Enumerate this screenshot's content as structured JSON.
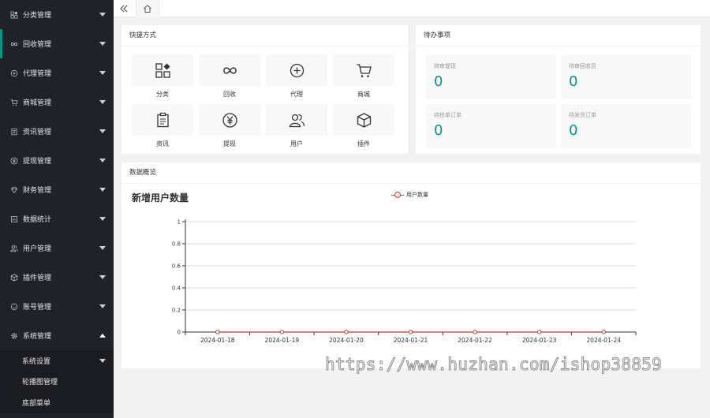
{
  "sidebar": {
    "items": [
      {
        "label": "分类管理",
        "icon": "category-icon"
      },
      {
        "label": "回收管理",
        "icon": "infinity-icon"
      },
      {
        "label": "代理管理",
        "icon": "plus-circle-icon"
      },
      {
        "label": "商城管理",
        "icon": "cart-icon"
      },
      {
        "label": "资讯管理",
        "icon": "document-icon"
      },
      {
        "label": "提现管理",
        "icon": "yen-icon"
      },
      {
        "label": "财务管理",
        "icon": "diamond-icon"
      },
      {
        "label": "数据统计",
        "icon": "chart-icon"
      },
      {
        "label": "用户管理",
        "icon": "users-icon"
      },
      {
        "label": "插件管理",
        "icon": "box-icon"
      },
      {
        "label": "账号管理",
        "icon": "smile-icon"
      },
      {
        "label": "系统管理",
        "icon": "gear-icon"
      }
    ],
    "active_index": 1,
    "expanded_index": 11,
    "submenu": [
      {
        "label": "系统设置"
      },
      {
        "label": "轮播图管理"
      },
      {
        "label": "底部菜单"
      }
    ]
  },
  "topbar": {
    "collapse_icon": "double-chevron-left-icon",
    "home_icon": "home-icon"
  },
  "quick": {
    "title": "快捷方式",
    "items": [
      {
        "label": "分类",
        "icon": "category-icon"
      },
      {
        "label": "回收",
        "icon": "infinity-icon"
      },
      {
        "label": "代理",
        "icon": "plus-circle-icon"
      },
      {
        "label": "商城",
        "icon": "cart-icon"
      },
      {
        "label": "资讯",
        "icon": "clipboard-icon"
      },
      {
        "label": "提现",
        "icon": "yen-icon"
      },
      {
        "label": "用户",
        "icon": "users-icon"
      },
      {
        "label": "插件",
        "icon": "box-icon"
      }
    ]
  },
  "todo": {
    "title": "待办事项",
    "items": [
      {
        "label": "待审提现",
        "value": "0"
      },
      {
        "label": "待审回收员",
        "value": "0"
      },
      {
        "label": "待抢单订单",
        "value": "0"
      },
      {
        "label": "待发货订单",
        "value": "0"
      }
    ]
  },
  "overview": {
    "title": "数据概览"
  },
  "chart_data": {
    "type": "line",
    "title": "新增用户数量",
    "x": [
      "2024-01-18",
      "2024-01-19",
      "2024-01-20",
      "2024-01-21",
      "2024-01-22",
      "2024-01-23",
      "2024-01-24"
    ],
    "series": [
      {
        "name": "用户数量",
        "values": [
          0,
          0,
          0,
          0,
          0,
          0,
          0
        ],
        "color": "#c23531"
      }
    ],
    "ylim": [
      0,
      1
    ],
    "yticks": [
      "0",
      "0.2",
      "0.4",
      "0.6",
      "0.8",
      "1"
    ],
    "grid": true,
    "legend": "top-center"
  },
  "watermark": "https://www.huzhan.com/ishop38859",
  "colors": {
    "accent": "#009688",
    "sidebar": "#20222a",
    "series": "#c23531"
  }
}
